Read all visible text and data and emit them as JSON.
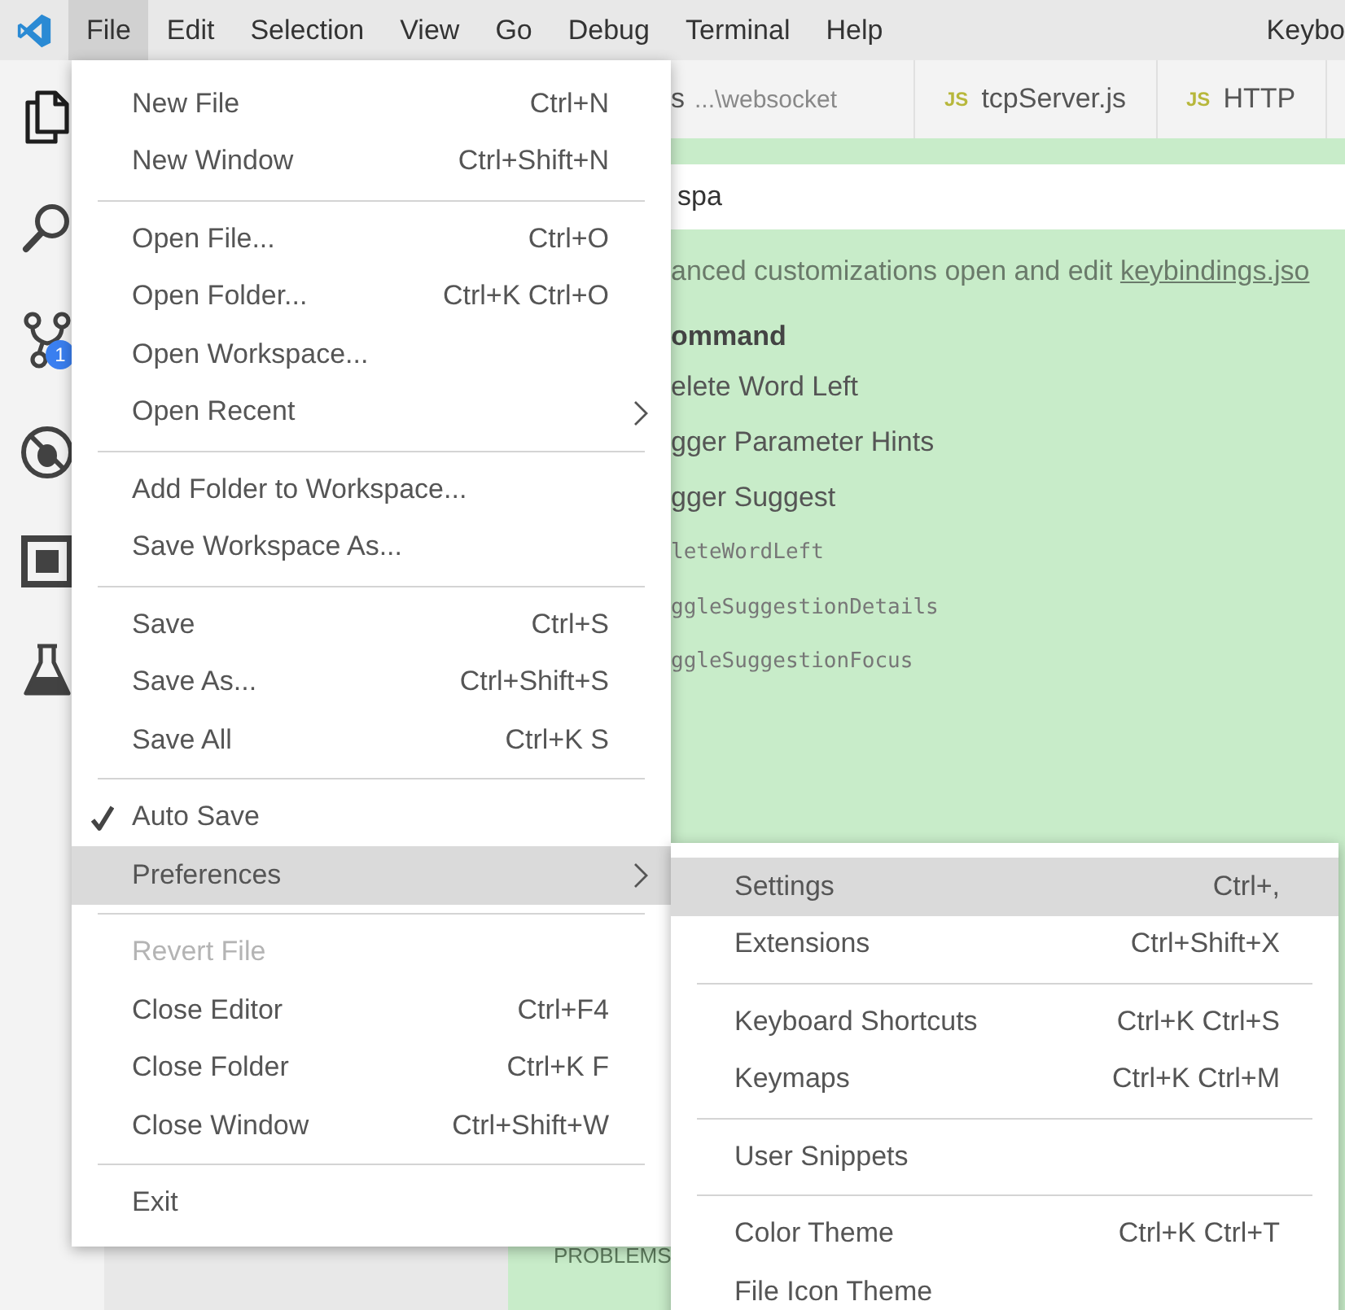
{
  "menubar": {
    "items": [
      {
        "label": "File",
        "selected": true
      },
      {
        "label": "Edit",
        "selected": false
      },
      {
        "label": "Selection",
        "selected": false
      },
      {
        "label": "View",
        "selected": false
      },
      {
        "label": "Go",
        "selected": false
      },
      {
        "label": "Debug",
        "selected": false
      },
      {
        "label": "Terminal",
        "selected": false
      },
      {
        "label": "Help",
        "selected": false
      }
    ],
    "title": "Keybo"
  },
  "activity_bar": {
    "source_control_badge": "1"
  },
  "tabs": [
    {
      "label": "s",
      "description": "...\\websocket"
    },
    {
      "icon": "JS",
      "label": "tcpServer.js"
    },
    {
      "icon": "JS",
      "label": "HTTP"
    }
  ],
  "keybindings": {
    "search_value": "spa",
    "hint": "anced customizations open and edit ",
    "link": "keybindings.jso",
    "column_header": "ommand",
    "commands": [
      "elete Word Left",
      "gger Parameter Hints",
      "gger Suggest"
    ],
    "command_ids": [
      "leteWordLeft",
      "ggleSuggestionDetails",
      "ggleSuggestionFocus"
    ]
  },
  "panel": {
    "tab": "PROBLEMS"
  },
  "file_menu": {
    "items": [
      {
        "kind": "item",
        "label": "New File",
        "shortcut": "Ctrl+N",
        "submenu": false,
        "checked": false,
        "disabled": false,
        "selected": false
      },
      {
        "kind": "item",
        "label": "New Window",
        "shortcut": "Ctrl+Shift+N",
        "submenu": false,
        "checked": false,
        "disabled": false,
        "selected": false
      },
      {
        "kind": "separator"
      },
      {
        "kind": "item",
        "label": "Open File...",
        "shortcut": "Ctrl+O",
        "submenu": false,
        "checked": false,
        "disabled": false,
        "selected": false
      },
      {
        "kind": "item",
        "label": "Open Folder...",
        "shortcut": "Ctrl+K Ctrl+O",
        "submenu": false,
        "checked": false,
        "disabled": false,
        "selected": false
      },
      {
        "kind": "item",
        "label": "Open Workspace...",
        "submenu": false,
        "checked": false,
        "disabled": false,
        "selected": false
      },
      {
        "kind": "item",
        "label": "Open Recent",
        "submenu": true,
        "checked": false,
        "disabled": false,
        "selected": false
      },
      {
        "kind": "separator"
      },
      {
        "kind": "item",
        "label": "Add Folder to Workspace...",
        "submenu": false,
        "checked": false,
        "disabled": false,
        "selected": false
      },
      {
        "kind": "item",
        "label": "Save Workspace As...",
        "submenu": false,
        "checked": false,
        "disabled": false,
        "selected": false
      },
      {
        "kind": "separator"
      },
      {
        "kind": "item",
        "label": "Save",
        "shortcut": "Ctrl+S",
        "submenu": false,
        "checked": false,
        "disabled": false,
        "selected": false
      },
      {
        "kind": "item",
        "label": "Save As...",
        "shortcut": "Ctrl+Shift+S",
        "submenu": false,
        "checked": false,
        "disabled": false,
        "selected": false
      },
      {
        "kind": "item",
        "label": "Save All",
        "shortcut": "Ctrl+K S",
        "submenu": false,
        "checked": false,
        "disabled": false,
        "selected": false
      },
      {
        "kind": "separator"
      },
      {
        "kind": "item",
        "label": "Auto Save",
        "submenu": false,
        "checked": true,
        "disabled": false,
        "selected": false
      },
      {
        "kind": "item",
        "label": "Preferences",
        "submenu": true,
        "checked": false,
        "disabled": false,
        "selected": true
      },
      {
        "kind": "separator"
      },
      {
        "kind": "item",
        "label": "Revert File",
        "submenu": false,
        "checked": false,
        "disabled": true,
        "selected": false
      },
      {
        "kind": "item",
        "label": "Close Editor",
        "shortcut": "Ctrl+F4",
        "submenu": false,
        "checked": false,
        "disabled": false,
        "selected": false
      },
      {
        "kind": "item",
        "label": "Close Folder",
        "shortcut": "Ctrl+K F",
        "submenu": false,
        "checked": false,
        "disabled": false,
        "selected": false
      },
      {
        "kind": "item",
        "label": "Close Window",
        "shortcut": "Ctrl+Shift+W",
        "submenu": false,
        "checked": false,
        "disabled": false,
        "selected": false
      },
      {
        "kind": "separator"
      },
      {
        "kind": "item",
        "label": "Exit",
        "submenu": false,
        "checked": false,
        "disabled": false,
        "selected": false
      }
    ]
  },
  "preferences_menu": {
    "items": [
      {
        "kind": "item",
        "label": "Settings",
        "shortcut": "Ctrl+,",
        "selected": true
      },
      {
        "kind": "item",
        "label": "Extensions",
        "shortcut": "Ctrl+Shift+X",
        "selected": false
      },
      {
        "kind": "separator"
      },
      {
        "kind": "item",
        "label": "Keyboard Shortcuts",
        "shortcut": "Ctrl+K Ctrl+S",
        "selected": false
      },
      {
        "kind": "item",
        "label": "Keymaps",
        "shortcut": "Ctrl+K Ctrl+M",
        "selected": false
      },
      {
        "kind": "separator"
      },
      {
        "kind": "item",
        "label": "User Snippets",
        "selected": false
      },
      {
        "kind": "separator"
      },
      {
        "kind": "item",
        "label": "Color Theme",
        "shortcut": "Ctrl+K Ctrl+T",
        "selected": false
      },
      {
        "kind": "item",
        "label": "File Icon Theme",
        "selected": false
      }
    ]
  }
}
